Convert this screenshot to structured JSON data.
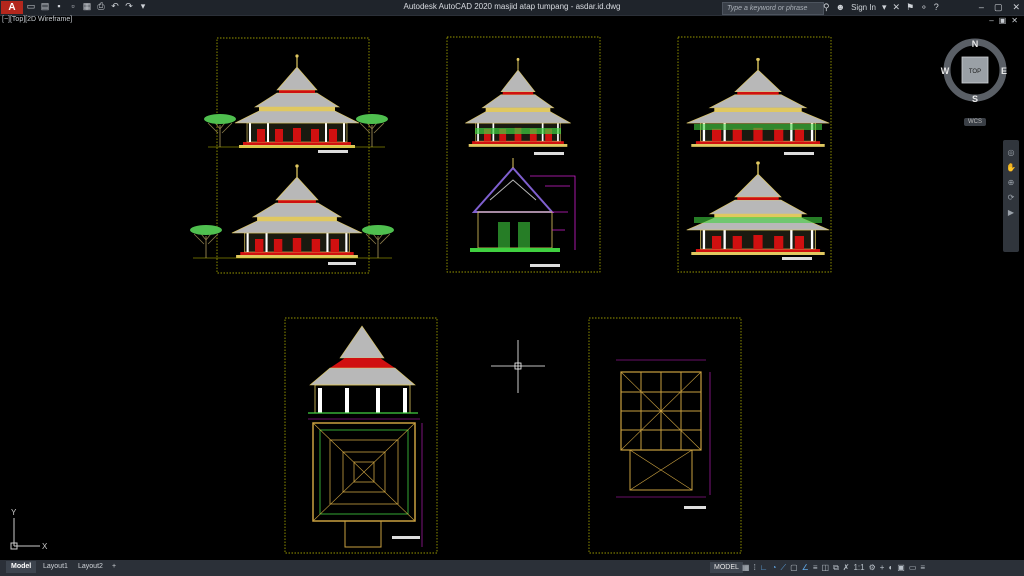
{
  "app": {
    "logo_letter": "A",
    "title": "Autodesk AutoCAD 2020   masjid atap tumpang - asdar.id.dwg",
    "search_placeholder": "Type a keyword or phrase",
    "sign_in": "Sign In"
  },
  "viewport": {
    "label": "[−][Top][2D Wireframe]",
    "viewcube": {
      "north": "N",
      "south": "S",
      "east": "E",
      "west": "W",
      "face": "TOP"
    },
    "wcs_label": "WCS",
    "ucs_x": "X",
    "ucs_y": "Y"
  },
  "tabs": [
    {
      "label": "Model",
      "active": true
    },
    {
      "label": "Layout1",
      "active": false
    },
    {
      "label": "Layout2",
      "active": false
    },
    {
      "label": "+",
      "active": false
    }
  ],
  "status": {
    "model": "MODEL",
    "scale": "1:1"
  },
  "colors": {
    "sheet_border": "#c8c800",
    "roof": "#b8b8b8",
    "ornament": "#e0c860",
    "door": "#d01010",
    "column": "#ffffff",
    "dimension": "#d020d0",
    "plan": "#c9a040",
    "green": "#40d040",
    "tree": "#4fbf4f"
  }
}
